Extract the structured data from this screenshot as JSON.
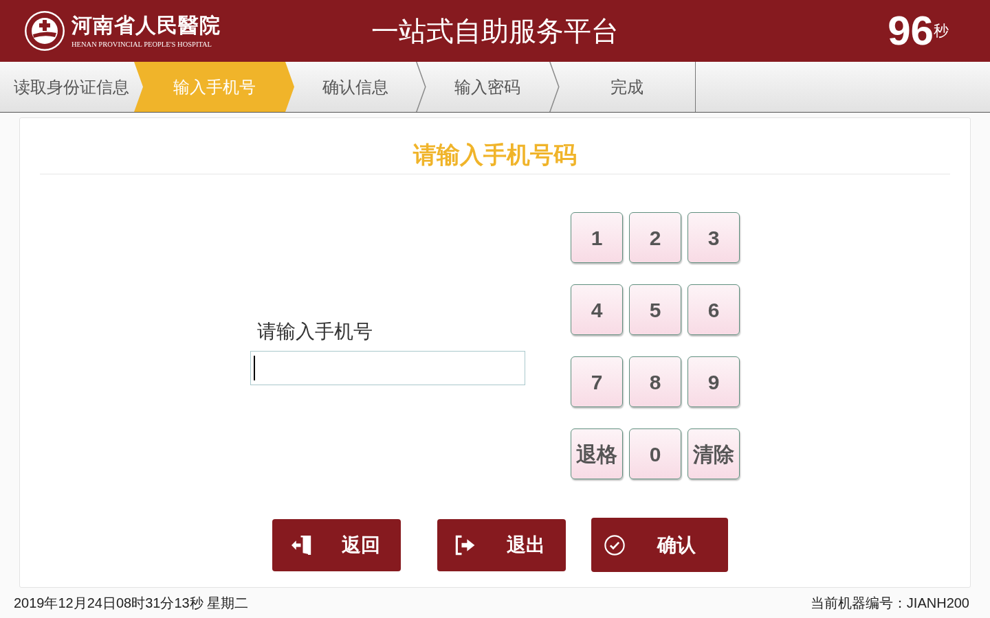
{
  "header": {
    "hospital": {
      "name": "河南省人民醫院",
      "subtitle": "HENAN PROVINCIAL PEOPLE'S HOSPITAL"
    },
    "title": "一站式自助服务平台",
    "countdown": {
      "value": "96",
      "unit": "秒"
    }
  },
  "steps": [
    {
      "label": "读取身份证信息",
      "selected": false
    },
    {
      "label": "输入手机号",
      "selected": true
    },
    {
      "label": "确认信息",
      "selected": false
    },
    {
      "label": "输入密码",
      "selected": false
    },
    {
      "label": "完成",
      "selected": false
    }
  ],
  "panel": {
    "title": "请输入手机号码",
    "phone_field": {
      "label": "请输入手机号",
      "focused": true
    }
  },
  "keypad": [
    "1",
    "2",
    "3",
    "4",
    "5",
    "6",
    "7",
    "8",
    "9",
    "退格",
    "0",
    "清除"
  ],
  "buttons": [
    {
      "kind": "back",
      "label": "返回"
    },
    {
      "kind": "exit",
      "label": "退出"
    },
    {
      "kind": "confirm",
      "label": "确认"
    }
  ],
  "footer": {
    "datetime": "2019年12月24日08时31分13秒 星期二",
    "machine": "当前机器编号：JIANH200"
  }
}
